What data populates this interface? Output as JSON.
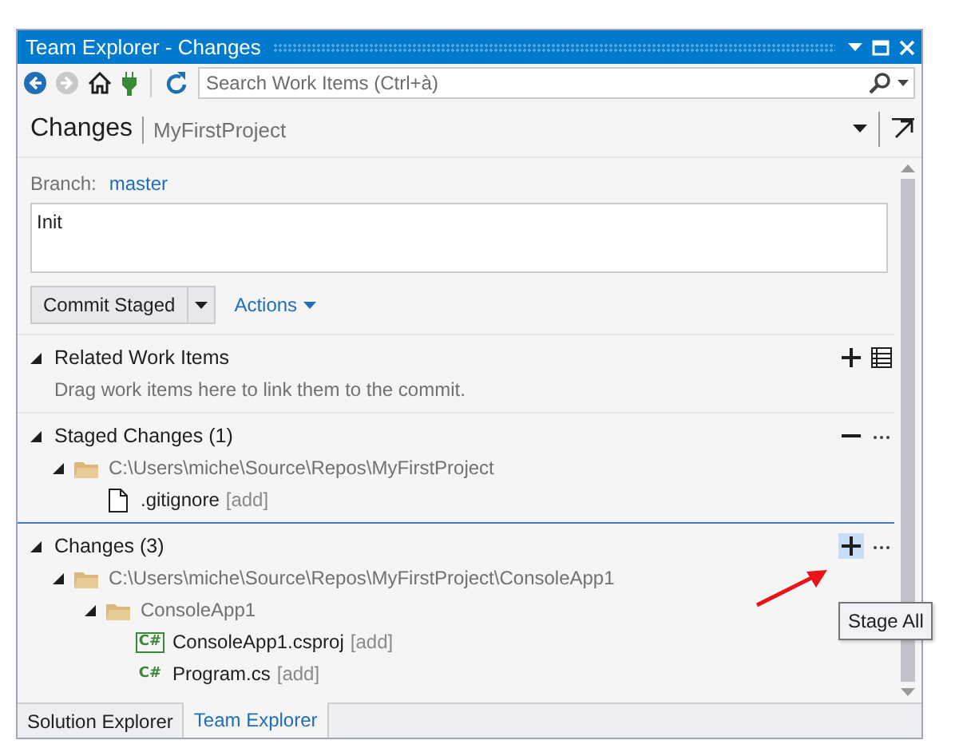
{
  "window": {
    "title": "Team Explorer - Changes"
  },
  "toolbar": {
    "search": {
      "placeholder": "Search Work Items (Ctrl+à)"
    }
  },
  "header": {
    "title": "Changes",
    "project": "MyFirstProject"
  },
  "branch": {
    "label": "Branch:",
    "name": "master"
  },
  "commit_message": {
    "value": "Init"
  },
  "commit_button": {
    "label": "Commit Staged"
  },
  "actions_link": {
    "label": "Actions"
  },
  "sections": [
    {
      "title": "Related Work Items",
      "expanded": true,
      "focused": false,
      "description": "Drag work items here to link them to the commit.",
      "actions": [
        {
          "kind": "add",
          "highlighted": false
        },
        {
          "kind": "list",
          "highlighted": false
        }
      ]
    },
    {
      "title": "Staged Changes (1)",
      "expanded": true,
      "focused": false,
      "actions": [
        {
          "kind": "remove",
          "highlighted": false
        },
        {
          "kind": "more",
          "highlighted": false
        }
      ],
      "tree": [
        {
          "kind": "folder",
          "label": "C:\\Users\\miche\\Source\\Repos\\MyFirstProject",
          "expanded": true,
          "children": [
            {
              "kind": "file",
              "label": ".gitignore",
              "status": "[add]"
            }
          ]
        }
      ]
    },
    {
      "title": "Changes (3)",
      "expanded": true,
      "focused": true,
      "actions": [
        {
          "kind": "add",
          "highlighted": true
        },
        {
          "kind": "more",
          "highlighted": false
        }
      ],
      "tree": [
        {
          "kind": "folder",
          "label": "C:\\Users\\miche\\Source\\Repos\\MyFirstProject\\ConsoleApp1",
          "expanded": true,
          "children": [
            {
              "kind": "folder",
              "label": "ConsoleApp1",
              "expanded": true,
              "children": [
                {
                  "kind": "csproj",
                  "icon_label": "C#",
                  "label": "ConsoleApp1.csproj",
                  "status": "[add]"
                },
                {
                  "kind": "cs",
                  "icon_label": "C#",
                  "label": "Program.cs",
                  "status": "[add]"
                }
              ]
            }
          ]
        }
      ]
    }
  ],
  "tooltip": {
    "text": "Stage All"
  },
  "bottom_tabs": [
    {
      "label": "Solution Explorer",
      "selected": false
    },
    {
      "label": "Team Explorer",
      "selected": true
    }
  ]
}
